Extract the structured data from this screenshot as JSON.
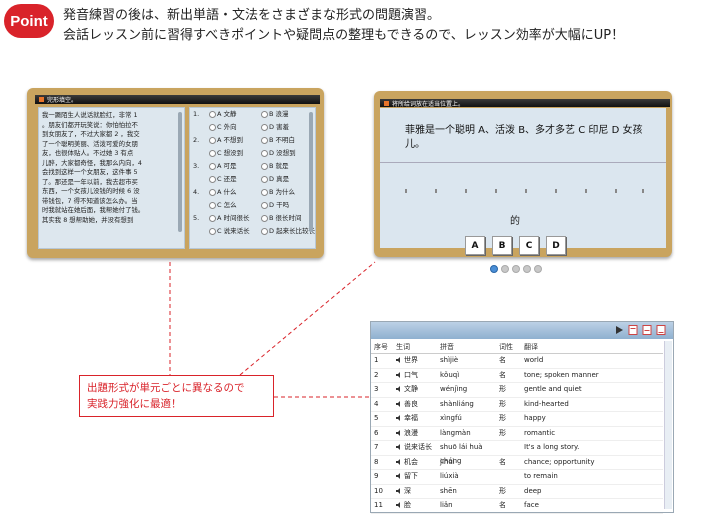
{
  "badge": "Point",
  "intro": {
    "line1": "発音練習の後は、新出単語・文法をさまざまな形式の問題演習。",
    "line2": "会話レッスン前に習得すべきポイントや疑問点の整理もできるので、レッスン効率が大幅にUP！"
  },
  "screen1": {
    "title": "完形填空。",
    "passage": "我一蹶陌生人说话就脸红，非常 1\n。朋友们都开玩笑说：你怕怕拉不\n到女朋友了，不过大家都 2 ，我交\n了一个聪明美丽、活泼可爱的女朋\n友，也很体贴人。不过她 3 有点\n儿醉，大家都奇怪，我那么内向，4\n会找到这样一个女朋友，这件事 5\n了。那还是一年以前，我去超市买\n东西，一个女孩儿没钱的时候 6 没\n带钱包，7 得不知道该怎么办。当\n时我就站在她后面，我帮她付了钱。\n其实我 8 想帮助她，并没有想到",
    "questions": [
      {
        "num": "1.",
        "a": "A 文静",
        "b": "B 浪漫",
        "c": "C 外向",
        "d": "D 害羞"
      },
      {
        "num": "2.",
        "a": "A 不想到",
        "b": "B 不明白",
        "c": "C 想没到",
        "d": "D 没想到"
      },
      {
        "num": "3.",
        "a": "A 可是",
        "b": "B 就是",
        "c": "C 还是",
        "d": "D 真是"
      },
      {
        "num": "4.",
        "a": "A 什么",
        "b": "B 为什么",
        "c": "C 怎么",
        "d": "D 干吗"
      },
      {
        "num": "5.",
        "a": "A 时间很长",
        "b": "B 很长时间",
        "c": "C 说来话长",
        "d": "D 起来长比较长"
      }
    ]
  },
  "screen2": {
    "title": "将所给词放在适当位置上。",
    "sentence": "菲雅是一个聪明 A、活泼 B、多才多艺 C 印尼 D 女孩儿。",
    "word": "的",
    "tiles": [
      "A",
      "B",
      "C",
      "D"
    ]
  },
  "screen3": {
    "headers": [
      "序号",
      "生词",
      "拼音",
      "词性",
      "翻译"
    ],
    "rows": [
      [
        "1",
        "世界",
        "shìjiè",
        "名",
        "world"
      ],
      [
        "2",
        "口气",
        "kǒuqì",
        "名",
        "tone; spoken manner"
      ],
      [
        "3",
        "文静",
        "wénjìng",
        "形",
        "gentle and quiet"
      ],
      [
        "4",
        "善良",
        "shànliáng",
        "形",
        "kind-hearted"
      ],
      [
        "5",
        "幸福",
        "xìngfú",
        "形",
        "happy"
      ],
      [
        "6",
        "浪漫",
        "làngmàn",
        "形",
        "romantic"
      ],
      [
        "7",
        "说来话长",
        "shuō lái huà cháng",
        "",
        "It's a long story."
      ],
      [
        "8",
        "机会",
        "jīhuì",
        "名",
        "chance; opportunity"
      ],
      [
        "9",
        "留下",
        "liúxià",
        "",
        "to remain"
      ],
      [
        "10",
        "深",
        "shēn",
        "形",
        "deep"
      ],
      [
        "11",
        "脸",
        "liǎn",
        "名",
        "face"
      ]
    ]
  },
  "callout": {
    "line1": "出題形式が単元ごとに異なるので",
    "line2": "実践力強化に最適！"
  },
  "colors": {
    "accent": "#d9232a",
    "frame": "#c9a45f",
    "panel": "#dde7ee"
  }
}
